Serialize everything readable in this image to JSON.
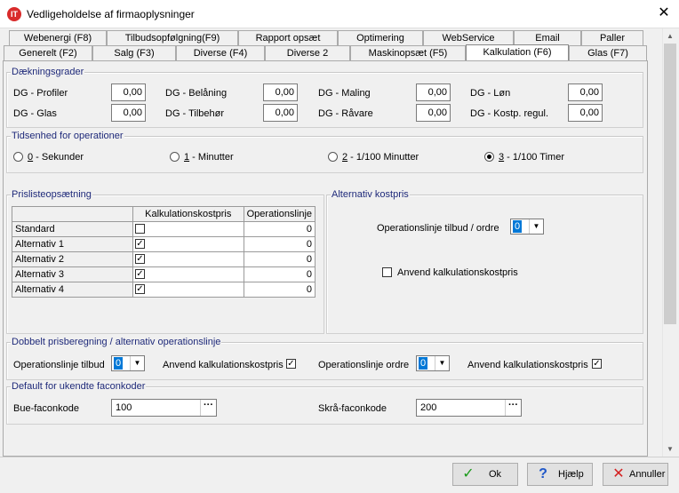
{
  "window": {
    "title": "Vedligeholdelse af firmaoplysninger",
    "icon_text": "IT",
    "close": "✕"
  },
  "tabs_row1": [
    "Webenergi (F8)",
    "Tilbudsopfølgning(F9)",
    "Rapport opsæt",
    "Optimering",
    "WebService",
    "Email",
    "Paller"
  ],
  "tabs_row2": [
    "Generelt (F2)",
    "Salg (F3)",
    "Diverse (F4)",
    "Diverse 2",
    "Maskinopsæt (F5)",
    "Kalkulation (F6)",
    "Glas (F7)"
  ],
  "daekning": {
    "title": "Dækningsgrader",
    "fields": [
      {
        "label": "DG - Profiler",
        "value": "0,00"
      },
      {
        "label": "DG - Belåning",
        "value": "0,00"
      },
      {
        "label": "DG - Maling",
        "value": "0,00"
      },
      {
        "label": "DG - Løn",
        "value": "0,00"
      },
      {
        "label": "DG - Glas",
        "value": "0,00"
      },
      {
        "label": "DG - Tilbehør",
        "value": "0,00"
      },
      {
        "label": "DG - Råvare",
        "value": "0,00"
      },
      {
        "label": "DG - Kostp. regul.",
        "value": "0,00"
      }
    ]
  },
  "tidsenhed": {
    "title": "Tidsenhed for operationer",
    "options": [
      {
        "key": "0",
        "label": " - Sekunder",
        "selected": false
      },
      {
        "key": "1",
        "label": " - Minutter",
        "selected": false
      },
      {
        "key": "2",
        "label": " - 1/100 Minutter",
        "selected": false
      },
      {
        "key": "3",
        "label": " - 1/100 Timer",
        "selected": true
      }
    ]
  },
  "prisliste": {
    "title": "Prislisteopsætning",
    "col_kalk": "Kalkulationskostpris",
    "col_op": "Operationslinje",
    "rows": [
      {
        "name": "Standard",
        "checked": false,
        "op": "0"
      },
      {
        "name": "Alternativ 1",
        "checked": true,
        "op": "0"
      },
      {
        "name": "Alternativ 2",
        "checked": true,
        "op": "0"
      },
      {
        "name": "Alternativ 3",
        "checked": true,
        "op": "0"
      },
      {
        "name": "Alternativ 4",
        "checked": true,
        "op": "0"
      }
    ]
  },
  "altkost": {
    "title": "Alternativ kostpris",
    "op_label": "Operationslinje tilbud / ordre",
    "op_value": "0",
    "anvend_label": "Anvend kalkulationskostpris",
    "anvend_checked": false
  },
  "dobbelt": {
    "title": "Dobbelt prisberegning / alternativ operationslinje",
    "tilbud_label": "Operationslinje tilbud",
    "tilbud_value": "0",
    "anvend1_label": "Anvend kalkulationskostpris",
    "anvend1_checked": true,
    "ordre_label": "Operationslinje ordre",
    "ordre_value": "0",
    "anvend2_label": "Anvend kalkulationskostpris",
    "anvend2_checked": true
  },
  "facon": {
    "title": "Default for ukendte faconkoder",
    "bue_label": "Bue-faconkode",
    "bue_value": "100",
    "skraa_label": "Skrå-faconkode",
    "skraa_value": "200",
    "dots": "···"
  },
  "buttons": {
    "ok": "Ok",
    "help": "Hjælp",
    "cancel": "Annuller"
  },
  "scroll": {
    "up": "▲",
    "down": "▼"
  },
  "check_glyph": "✓",
  "arrow_glyph": "▼"
}
